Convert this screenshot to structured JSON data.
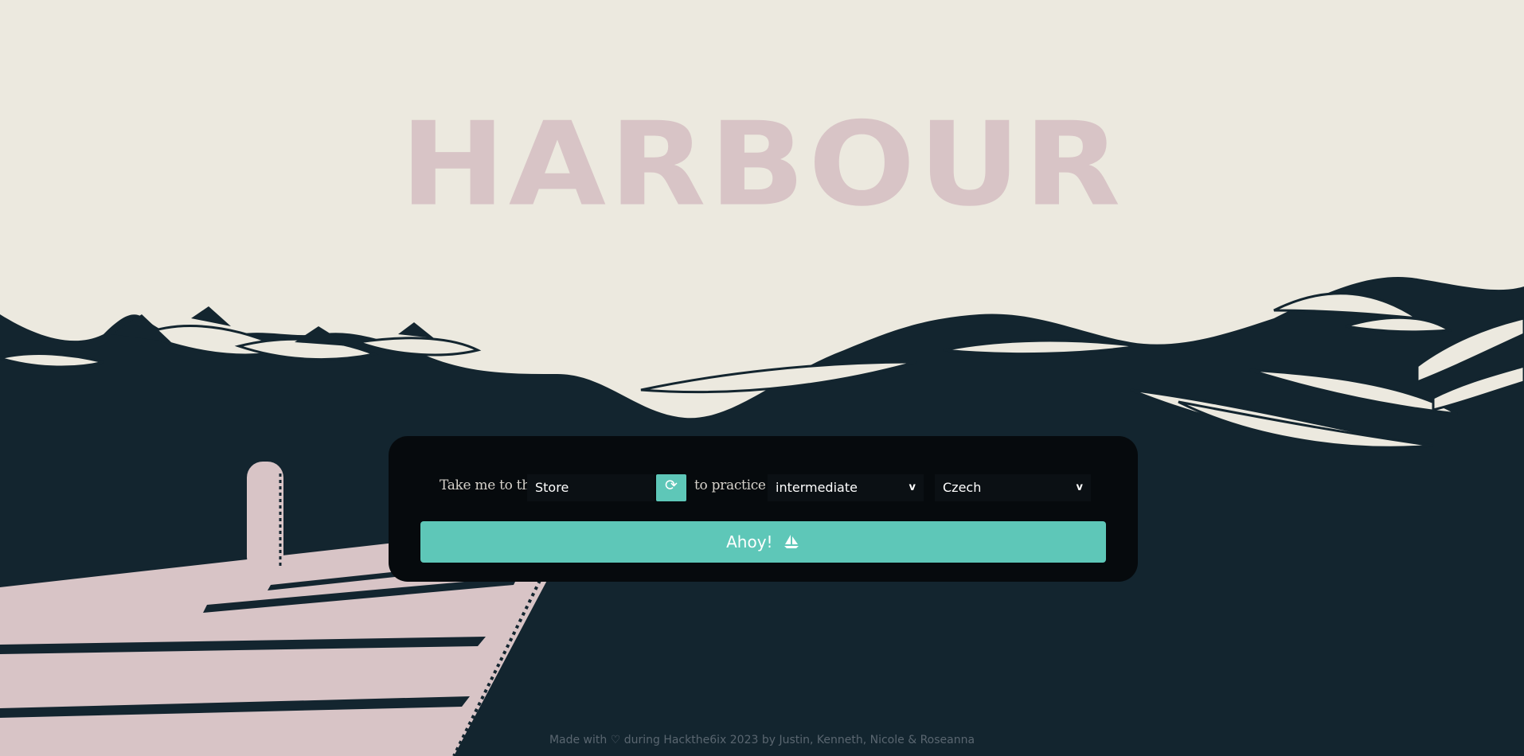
{
  "title": "HARBOUR",
  "form": {
    "label_destination": "Take me to the",
    "destination_value": "Store",
    "refresh_icon": "refresh-icon",
    "label_practice": "to practice",
    "level_value": "intermediate",
    "language_value": "Czech",
    "dropdown_glyph": "v",
    "submit_label": "Ahoy!",
    "submit_icon": "sailboat-icon"
  },
  "footer": "Made with ♡ during Hackthe6ix 2023 by Justin, Kenneth, Nicole & Roseanna",
  "colors": {
    "background": "#ece9df",
    "sea": "#13252f",
    "title": "#d8c4c6",
    "dock": "#d8c4c6",
    "panel": "#060a0d",
    "accent": "#5ec7b8"
  }
}
